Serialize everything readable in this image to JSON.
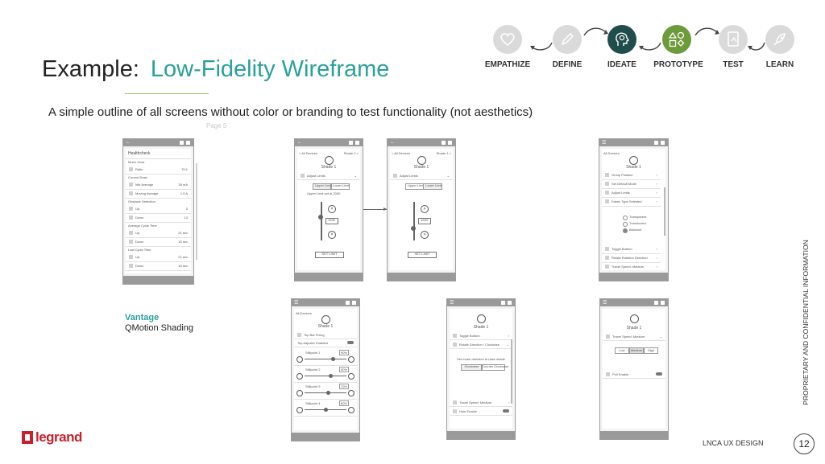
{
  "slide": {
    "title_prefix": "Example:",
    "title_accent": "Low-Fidelity Wireframe",
    "subtitle": "A simple outline of all screens without color or branding to test functionality (not aesthetics)",
    "page_label": "Page 5",
    "caption_brand": "Vantage",
    "caption_product": "QMotion Shading",
    "side_text": "PROPRIETARY AND CONFIDENTIAL INFORMATION",
    "footer": "LNCA UX DESIGN",
    "page_number": "12",
    "brand_word": "legrand"
  },
  "steps": [
    {
      "label": "EMPATHIZE",
      "icon": "heart-icon"
    },
    {
      "label": "DEFINE",
      "icon": "pencil-icon"
    },
    {
      "label": "IDEATE",
      "icon": "lightbulb-head-icon"
    },
    {
      "label": "PROTOTYPE",
      "icon": "shapes-icon"
    },
    {
      "label": "TEST",
      "icon": "tablet-icon"
    },
    {
      "label": "LEARN",
      "icon": "rocket-icon"
    }
  ],
  "colors": {
    "accent": "#2aa19a",
    "ideate": "#1f4d4b",
    "prototype": "#6d9a3b",
    "brand": "#c8202f"
  },
  "wire1": {
    "header": "Healthcheck",
    "sections": [
      {
        "title": "Motor Gear",
        "rows": [
          [
            "Ratio",
            "70:1"
          ]
        ]
      },
      {
        "title": "Current Draw",
        "rows": [
          [
            "Idle Average",
            "28 mA"
          ],
          [
            "Moving Average",
            "1.5 A"
          ]
        ]
      },
      {
        "title": "Obstacle Detection",
        "rows": [
          [
            "Up",
            "0"
          ],
          [
            "Down",
            "13"
          ]
        ]
      },
      {
        "title": "Average Cycle Time",
        "rows": [
          [
            "Up",
            "21 sec"
          ],
          [
            "Down",
            "18 sec"
          ]
        ]
      },
      {
        "title": "Last Cycle Time",
        "rows": [
          [
            "Up",
            "21 sec"
          ],
          [
            "Down",
            "18 sec"
          ]
        ]
      }
    ]
  },
  "wire_shade": {
    "back": "< All Devices",
    "shade_name": "Shade 1",
    "shade_id": "Shade 1 >",
    "row": "Adjust Limits",
    "tab_upper": "Upper Limit",
    "tab_lower": "Lower Limit",
    "hint": "Upper Limit set at 2000",
    "value": "1930",
    "set_button": "SET LIMIT"
  },
  "wire_menu": {
    "back": "All Devices",
    "shade_name": "Shade 1",
    "items": [
      "Group Position",
      "Set Default Mode",
      "Adjust Limits",
      "Fabric Type Selected"
    ],
    "options": [
      "Transparent",
      "Translucent",
      "Blackout"
    ],
    "items2": [
      "Toggle Bottom",
      "Rotate Rotation Direction",
      "Travel Speed: Medium"
    ]
  },
  "wire_slider": {
    "back": "All Devices",
    "shade_name": "Shade 1",
    "row1": "Top Bar Fixing",
    "row2": "Top Adjuster Enabled",
    "labels": [
      "Stillpoint 1",
      "Stillpoint 2",
      "Stillpoint 3",
      "Stillpoint 4"
    ],
    "pcts": [
      "90%",
      "80%",
      "70%",
      "60%"
    ]
  },
  "wire_dir": {
    "shade_name": "Shade 1",
    "row1": "Toggle Bottom",
    "row2": "Rotate Direction / Clockwise",
    "prompt": "Set motor direction to raise shade",
    "opt1": "Clockwise",
    "opt2": "Counter Clockwise",
    "row3": "Travel Speed: Medium",
    "row4": "Hole Enable"
  },
  "wire_speed": {
    "shade_name": "Shade 1",
    "row1": "Travel Speed: Medium",
    "opts": [
      "Low",
      "Medium",
      "High"
    ],
    "row2": "Pull Enable"
  }
}
